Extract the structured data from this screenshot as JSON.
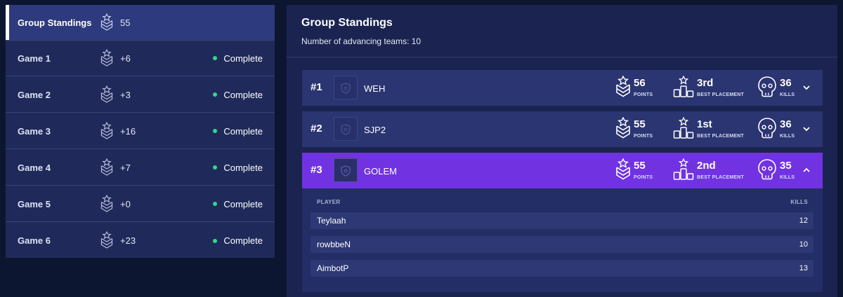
{
  "games": [
    {
      "name": "Group Standings",
      "points": "55",
      "status": "",
      "active": true
    },
    {
      "name": "Game 1",
      "points": "+6",
      "status": "Complete"
    },
    {
      "name": "Game 2",
      "points": "+3",
      "status": "Complete"
    },
    {
      "name": "Game 3",
      "points": "+16",
      "status": "Complete"
    },
    {
      "name": "Game 4",
      "points": "+7",
      "status": "Complete"
    },
    {
      "name": "Game 5",
      "points": "+0",
      "status": "Complete"
    },
    {
      "name": "Game 6",
      "points": "+23",
      "status": "Complete"
    }
  ],
  "standings": {
    "title": "Group Standings",
    "subtitle": "Number of advancing teams: 10",
    "points_label": "POINTS",
    "placement_label": "BEST PLACEMENT",
    "kills_label": "KILLS",
    "teams": [
      {
        "rank": "#1",
        "name": "WEH",
        "points": "56",
        "best_placement": "3rd",
        "kills": "36",
        "expanded": false
      },
      {
        "rank": "#2",
        "name": "SJP2",
        "points": "55",
        "best_placement": "1st",
        "kills": "36",
        "expanded": false
      },
      {
        "rank": "#3",
        "name": "GOLEM",
        "points": "55",
        "best_placement": "2nd",
        "kills": "35",
        "expanded": true
      }
    ],
    "players_table": {
      "col_player": "PLAYER",
      "col_kills": "KILLS",
      "rows": [
        {
          "player": "Teylaah",
          "kills": "12"
        },
        {
          "player": "rowbbeN",
          "kills": "10"
        },
        {
          "player": "AimbotP",
          "kills": "13"
        }
      ]
    }
  },
  "colors": {
    "page_bg": "#0d1630",
    "panel_bg": "#1f2a5a",
    "active_row": "#2d3a7d",
    "team_row": "#2b3572",
    "expanded_team": "#7133e2",
    "status_dot": "#35d68c"
  },
  "icons": {
    "rank_badge": "rank-chevron-icon",
    "placement": "podium-star-icon",
    "kills": "skull-icon",
    "expand": "chevron-down-icon",
    "collapse": "chevron-up-icon",
    "team_logo": "shield-placeholder-icon"
  }
}
